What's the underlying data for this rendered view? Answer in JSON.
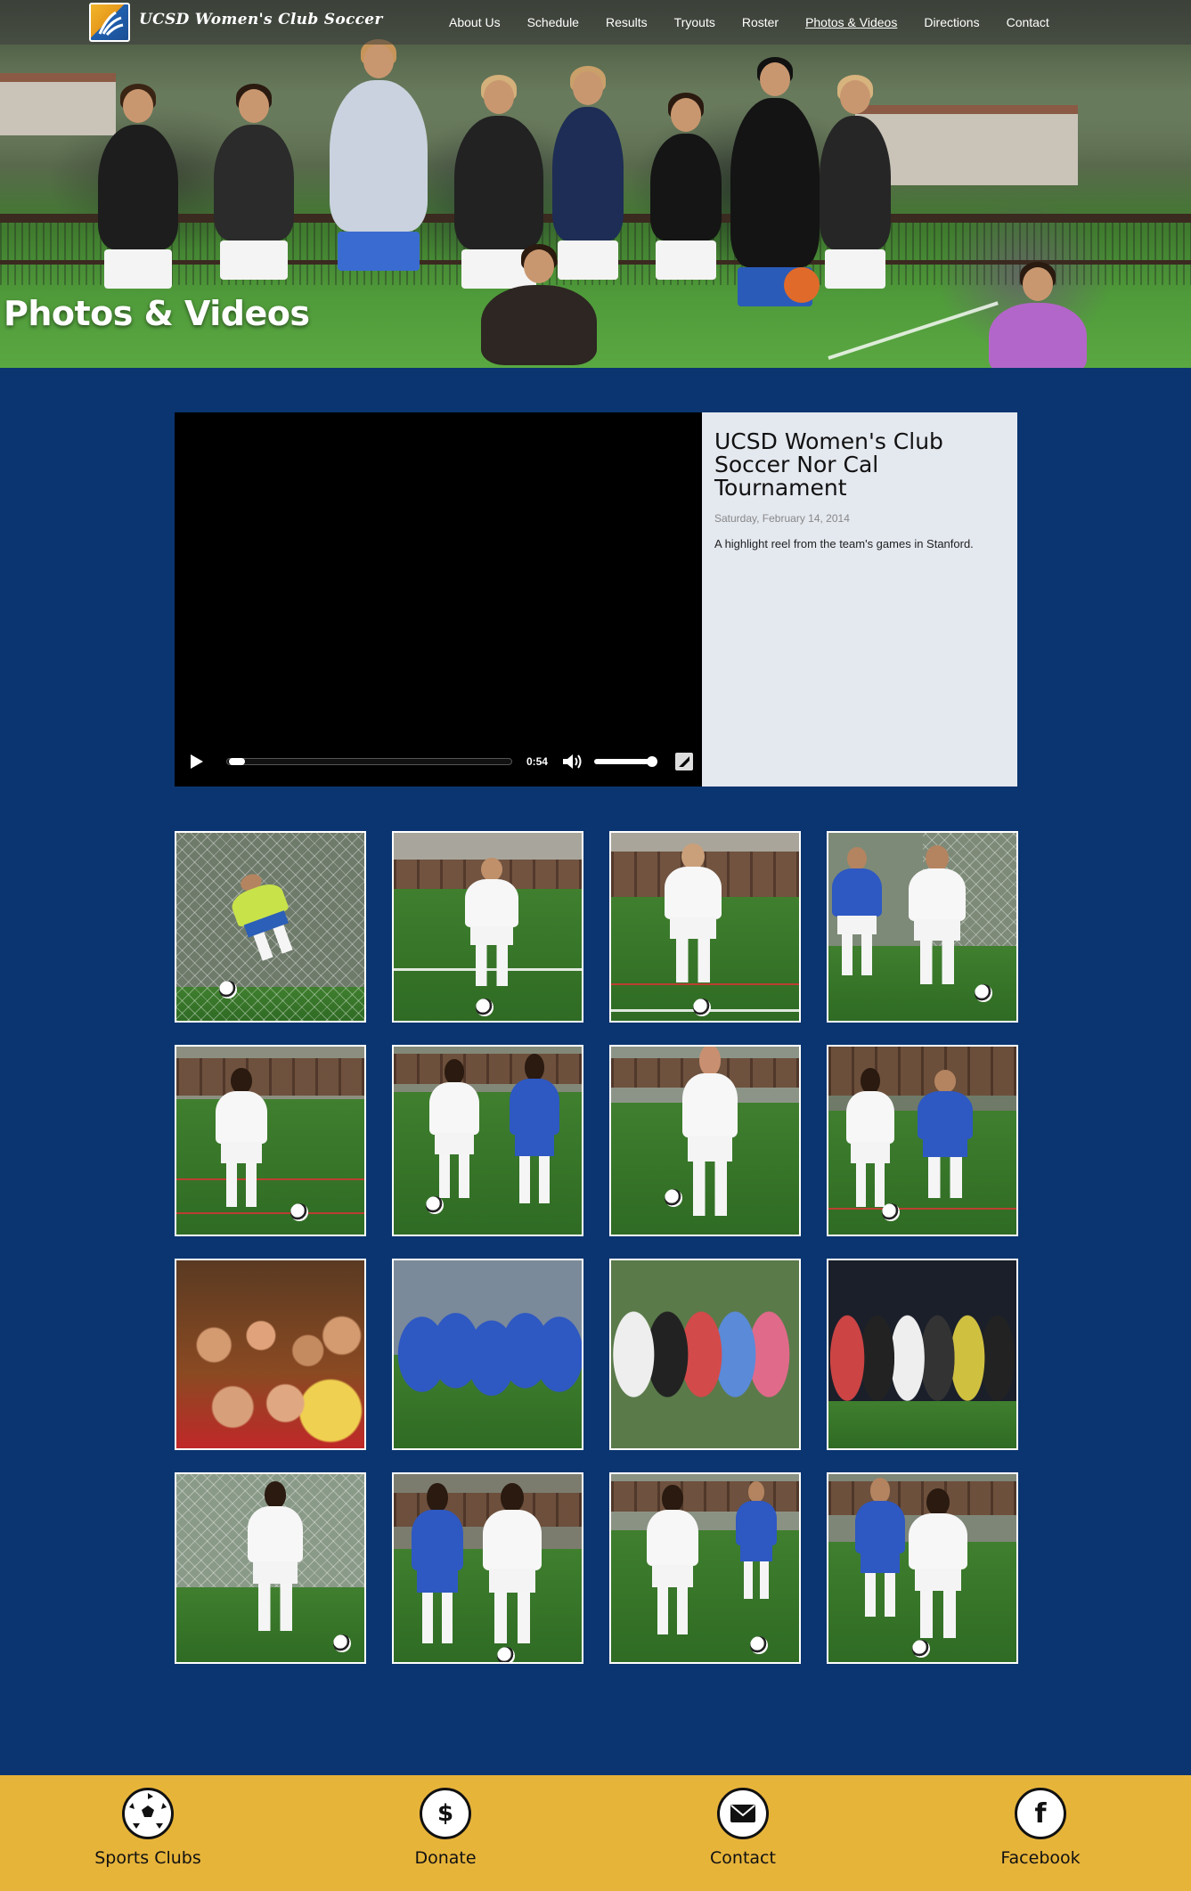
{
  "header": {
    "brand": "UCSD Women's Club Soccer",
    "nav": [
      {
        "label": "About Us",
        "active": false
      },
      {
        "label": "Schedule",
        "active": false
      },
      {
        "label": "Results",
        "active": false
      },
      {
        "label": "Tryouts",
        "active": false
      },
      {
        "label": "Roster",
        "active": false
      },
      {
        "label": "Photos & Videos",
        "active": true
      },
      {
        "label": "Directions",
        "active": false
      },
      {
        "label": "Contact",
        "active": false
      }
    ]
  },
  "hero": {
    "title": "Photos & Videos"
  },
  "video": {
    "duration": "0:54",
    "title": "UCSD Women's Club Soccer Nor Cal Tournament",
    "date": "Saturday, February 14, 2014",
    "description": "A highlight reel from the team's games in Stanford."
  },
  "gallery": {
    "photo_count": 16
  },
  "footer": {
    "items": [
      {
        "label": "Sports Clubs",
        "icon": "soccer-ball-icon"
      },
      {
        "label": "Donate",
        "icon": "dollar-icon"
      },
      {
        "label": "Contact",
        "icon": "envelope-icon"
      },
      {
        "label": "Facebook",
        "icon": "facebook-icon"
      }
    ]
  },
  "colors": {
    "page_bg": "#0a3570",
    "footer_bg": "#e7b43a",
    "info_panel_bg": "#e4e8ef"
  }
}
